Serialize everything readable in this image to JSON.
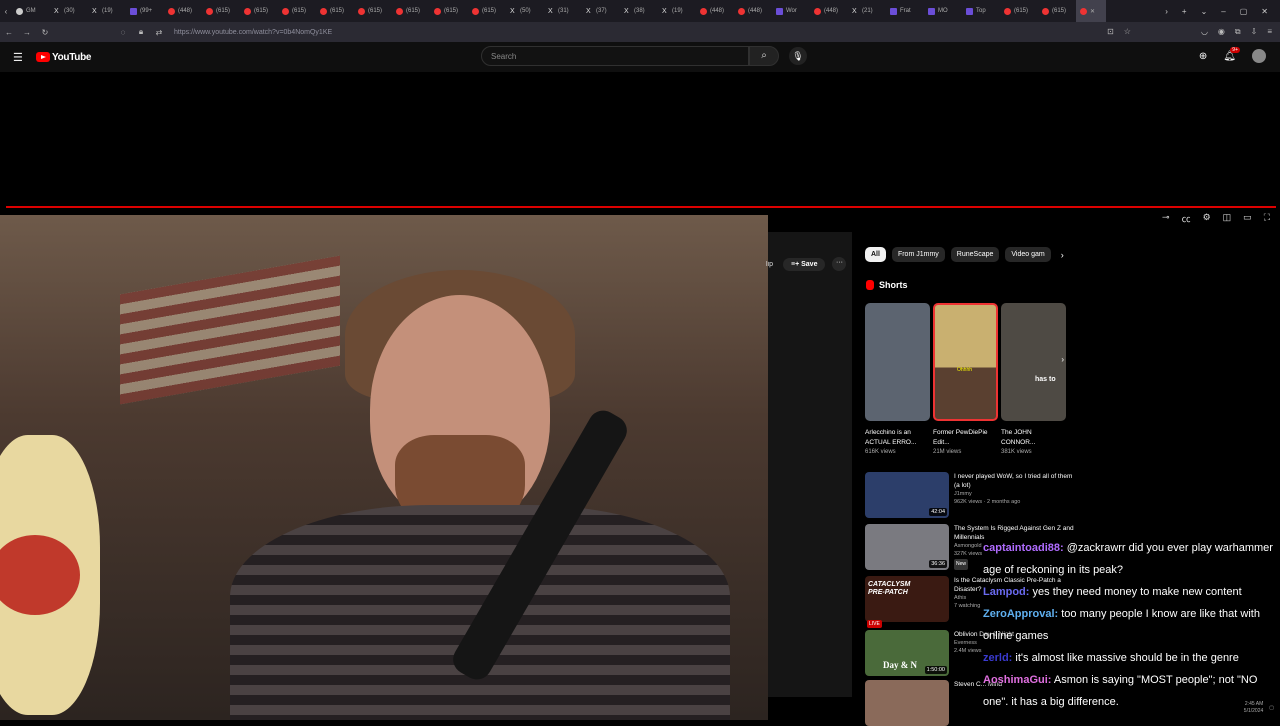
{
  "browser": {
    "tabs": [
      {
        "label": "GM",
        "favicon": "gmail-icon"
      },
      {
        "label": "(30)",
        "favicon": "x-icon"
      },
      {
        "label": "(19)",
        "favicon": "x-icon"
      },
      {
        "label": "(99+",
        "favicon": "app-icon"
      },
      {
        "label": "(448)",
        "favicon": "youtube-icon"
      },
      {
        "label": "(615)",
        "favicon": "youtube-icon"
      },
      {
        "label": "(615)",
        "favicon": "youtube-icon"
      },
      {
        "label": "(615)",
        "favicon": "youtube-icon"
      },
      {
        "label": "(615)",
        "favicon": "youtube-icon"
      },
      {
        "label": "(615)",
        "favicon": "youtube-icon"
      },
      {
        "label": "(615)",
        "favicon": "youtube-icon"
      },
      {
        "label": "(615)",
        "favicon": "youtube-icon"
      },
      {
        "label": "(615)",
        "favicon": "youtube-icon"
      },
      {
        "label": "(50)",
        "favicon": "x-icon"
      },
      {
        "label": "(31)",
        "favicon": "x-icon"
      },
      {
        "label": "(37)",
        "favicon": "x-icon"
      },
      {
        "label": "(38)",
        "favicon": "x-icon"
      },
      {
        "label": "(19)",
        "favicon": "x-icon"
      },
      {
        "label": "(448)",
        "favicon": "youtube-icon"
      },
      {
        "label": "(448)",
        "favicon": "youtube-icon"
      },
      {
        "label": "Wor",
        "favicon": "app-icon"
      },
      {
        "label": "(448)",
        "favicon": "youtube-icon"
      },
      {
        "label": "(21)",
        "favicon": "x-icon"
      },
      {
        "label": "Frat",
        "favicon": "app-icon"
      },
      {
        "label": "MO",
        "favicon": "app-icon"
      },
      {
        "label": "Top",
        "favicon": "app-icon"
      },
      {
        "label": "(615)",
        "favicon": "youtube-icon"
      },
      {
        "label": "(615)",
        "favicon": "youtube-icon"
      }
    ],
    "url": "https://www.youtube.com/watch?v=0b4NomQy1KE"
  },
  "header": {
    "logo_text": "YouTube",
    "search_placeholder": "Search",
    "notification_count": "9+"
  },
  "chips": {
    "clip_label": "lip",
    "save_label": "Save",
    "more_label": "···"
  },
  "filters": [
    "All",
    "From J1mmy",
    "RuneScape",
    "Video gam"
  ],
  "shorts": {
    "title": "Shorts",
    "items": [
      {
        "title": "Arlecchino is an ACTUAL ERRO...",
        "views": "616K views",
        "color": "#5c6470"
      },
      {
        "title": "Former PewDiePie Edit...",
        "views": "21M views",
        "color": "#b8652e"
      },
      {
        "title": "The JOHN CONNOR...",
        "views": "381K views",
        "color": "#4e4a44"
      }
    ],
    "overlay_text_1": "Ohhhh",
    "overlay_text_2": "has to"
  },
  "videos": [
    {
      "title": "I never played WoW, so I tried all of them (a lot)",
      "channel": "J1mmy",
      "meta": "962K views · 2 months ago",
      "duration": "42:04",
      "color": "#2c3e6a"
    },
    {
      "title": "The System Is Rigged Against Gen Z and Millennials",
      "channel": "Asmongold",
      "meta": "327K views",
      "badge": "New",
      "duration": "36:36",
      "color": "#7a7a80"
    },
    {
      "title": "Is the Cataclysm Classic Pre-Patch a Disaster?",
      "channel": "Athis",
      "meta": "7 watching",
      "badge": "LIVE",
      "thumb_text": "CATACLYSM PRE-PATCH",
      "color": "#3a1a12"
    },
    {
      "title": "Oblivion Day & Night",
      "channel": "Everness",
      "meta": "2.4M views",
      "duration": "1:50:00",
      "thumb_text": "Day & N",
      "color": "#4a6a3a"
    },
    {
      "title": "Steven C... Mind",
      "channel": "",
      "meta": "",
      "color": "#8a6a5a"
    }
  ],
  "chat": [
    {
      "user": "captaintoadi88:",
      "color": "#b06cff",
      "text": "@zackrawrr did you ever play warhammer age of reckoning in its peak?"
    },
    {
      "user": "Lampod:",
      "color": "#6a6af0",
      "text": "yes they need money to make new content"
    },
    {
      "user": "ZeroApproval:",
      "color": "#5fb0f0",
      "text": "too many people I know are like that with online games"
    },
    {
      "user": "zerld:",
      "color": "#3a3ad0",
      "text": "it's almost like massive should be in the genre"
    },
    {
      "user": "AoshimaGui:",
      "color": "#e070e0",
      "text": "Asmon is saying \"MOST people\"; not \"NO one\". it has a big difference."
    }
  ],
  "taskbar": {
    "time": "2:45 AM",
    "date": "5/1/2024"
  }
}
